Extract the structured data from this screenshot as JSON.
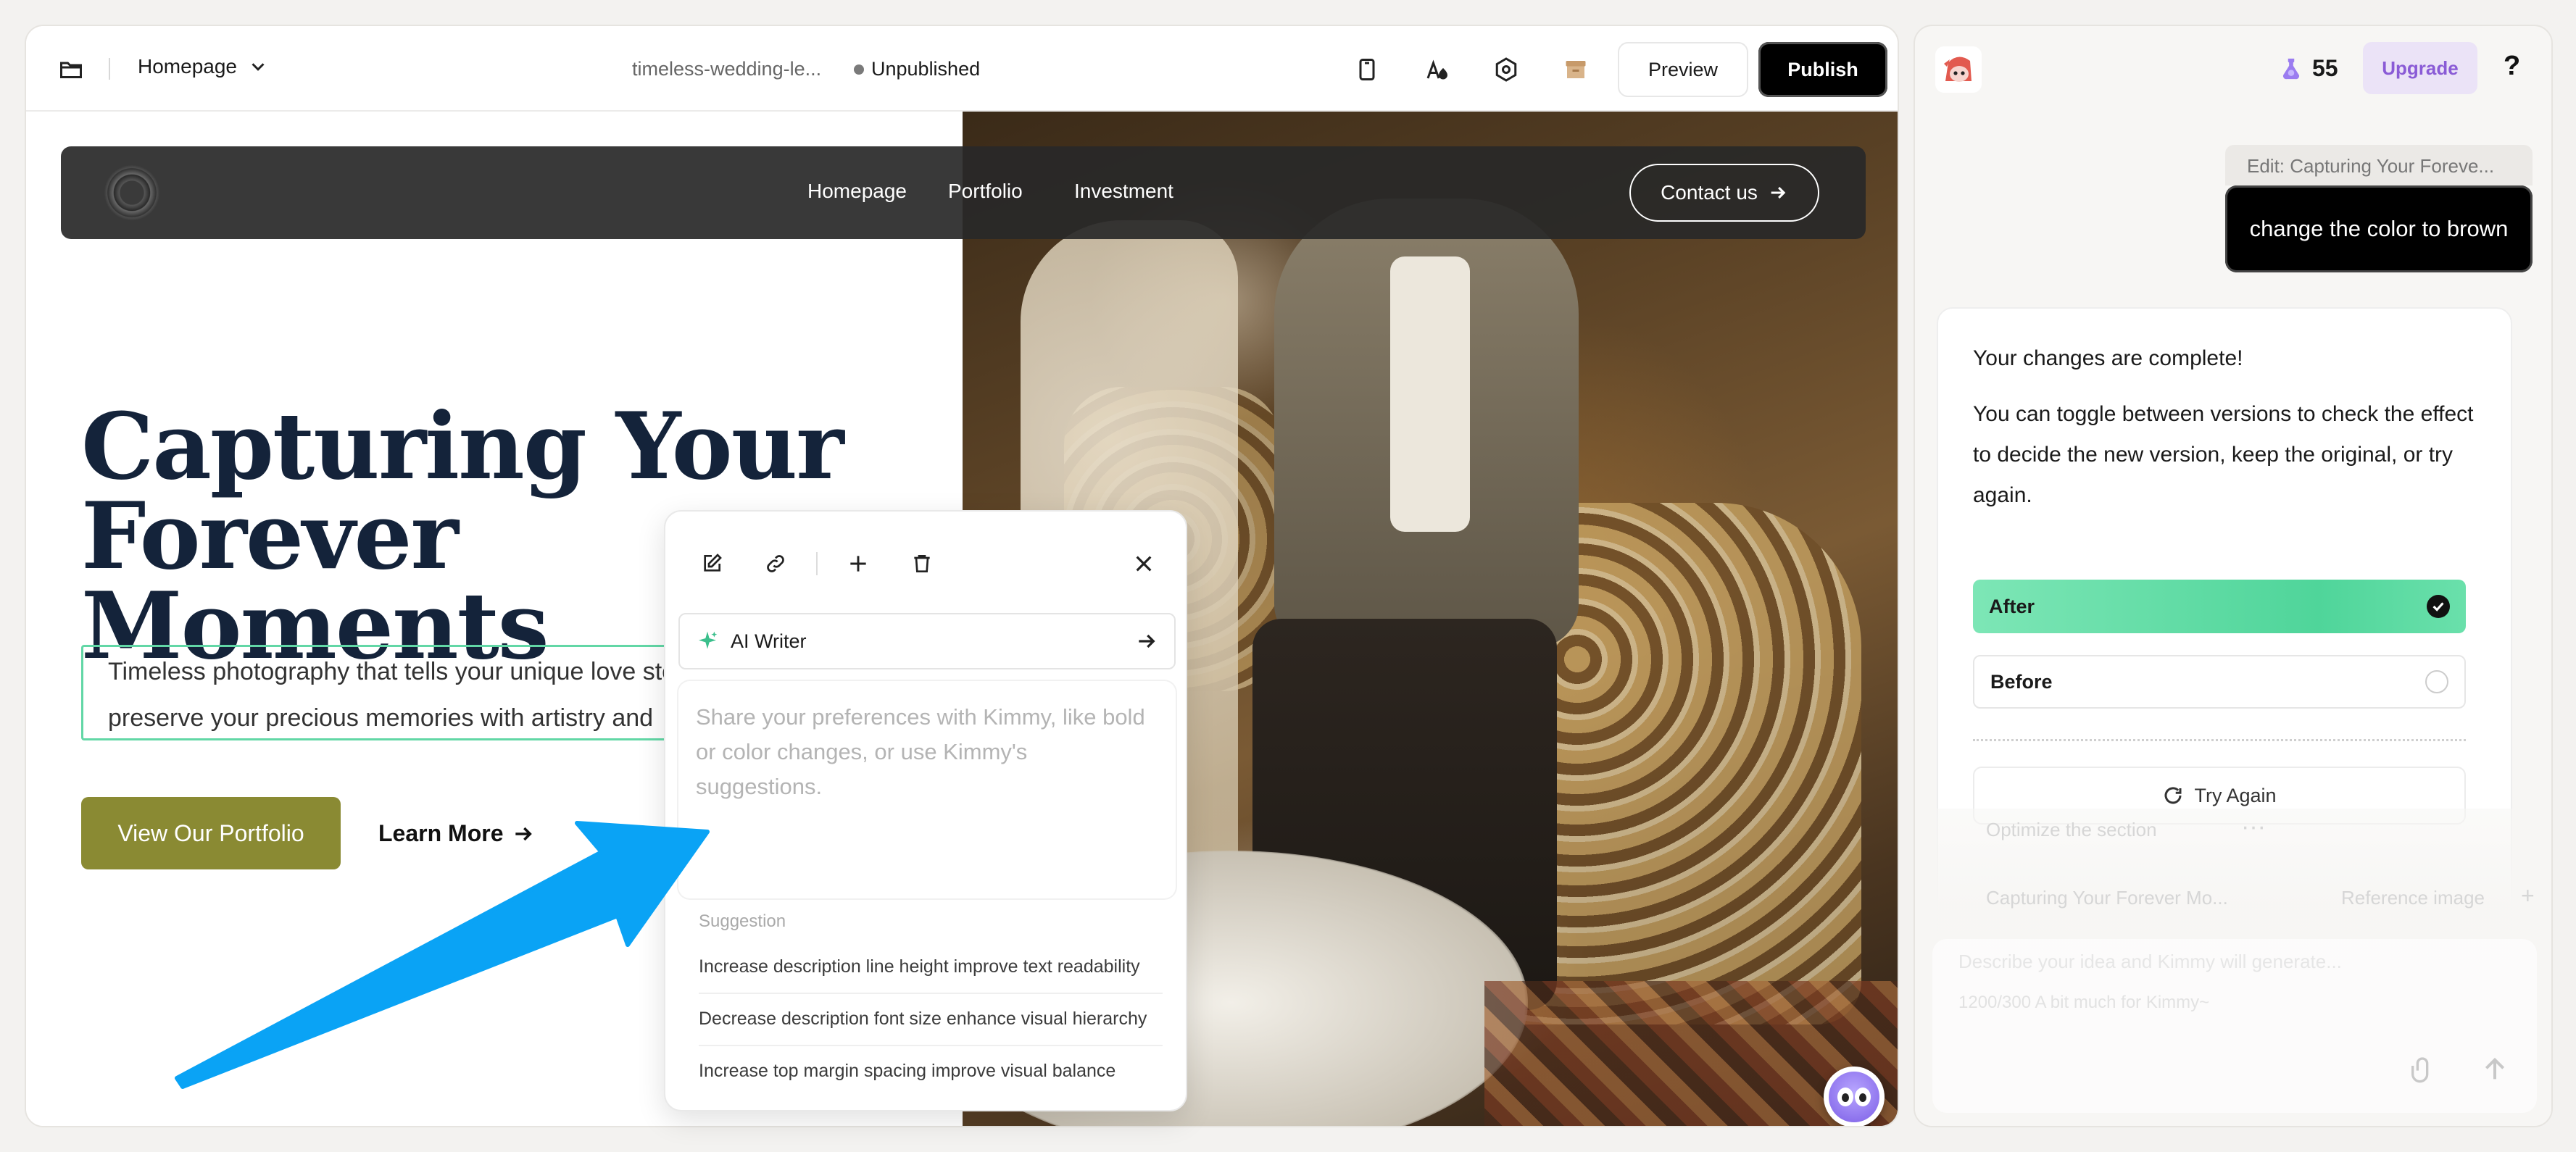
{
  "topbar": {
    "page_selector": "Homepage",
    "file_name": "timeless-wedding-le...",
    "status": "Unpublished",
    "preview_label": "Preview",
    "publish_label": "Publish"
  },
  "site": {
    "nav": [
      "Homepage",
      "Portfolio",
      "Investment"
    ],
    "contact_label": "Contact us",
    "hero_title_line1": "Capturing Your",
    "hero_title_line2": "Forever Moments",
    "hero_desc_line1": "Timeless photography that tells your unique love story. We",
    "hero_desc_line2": "preserve your precious memories with artistry and",
    "portfolio_button": "View Our Portfolio",
    "learn_more": "Learn More"
  },
  "popover": {
    "ai_writer_label": "AI Writer",
    "input_placeholder": "Share your preferences with Kimmy, like bold or color changes, or use Kimmy's suggestions.",
    "suggestion_title": "Suggestion",
    "suggestions": [
      "Increase description line height improve text readability",
      "Decrease description font size enhance visual hierarchy",
      "Increase top margin spacing improve visual balance"
    ]
  },
  "chat": {
    "credits": "55",
    "upgrade_label": "Upgrade",
    "help_label": "?",
    "edit_context": "Edit:  Capturing Your Foreve...",
    "user_message": "change the color to brown",
    "bot_title": "Your changes are complete!",
    "bot_text": "You can toggle between versions to check the effect to decide the new version, keep the original, or try again.",
    "option_after": "After",
    "option_before": "Before",
    "try_again": "Try Again",
    "faded_optimize": "Optimize the section",
    "faded_section": "Capturing Your Forever Mo...",
    "faded_reference": "Reference image",
    "faded_placeholder": "Describe your idea and Kimmy will generate...",
    "faded_counter": "1200/300  A bit much for Kimmy~"
  },
  "colors": {
    "accent_green": "#62d7a6",
    "portfolio_olive": "#8a8a33",
    "upgrade_purple": "#8a5bd6",
    "arrow_blue": "#0aa3f5"
  }
}
